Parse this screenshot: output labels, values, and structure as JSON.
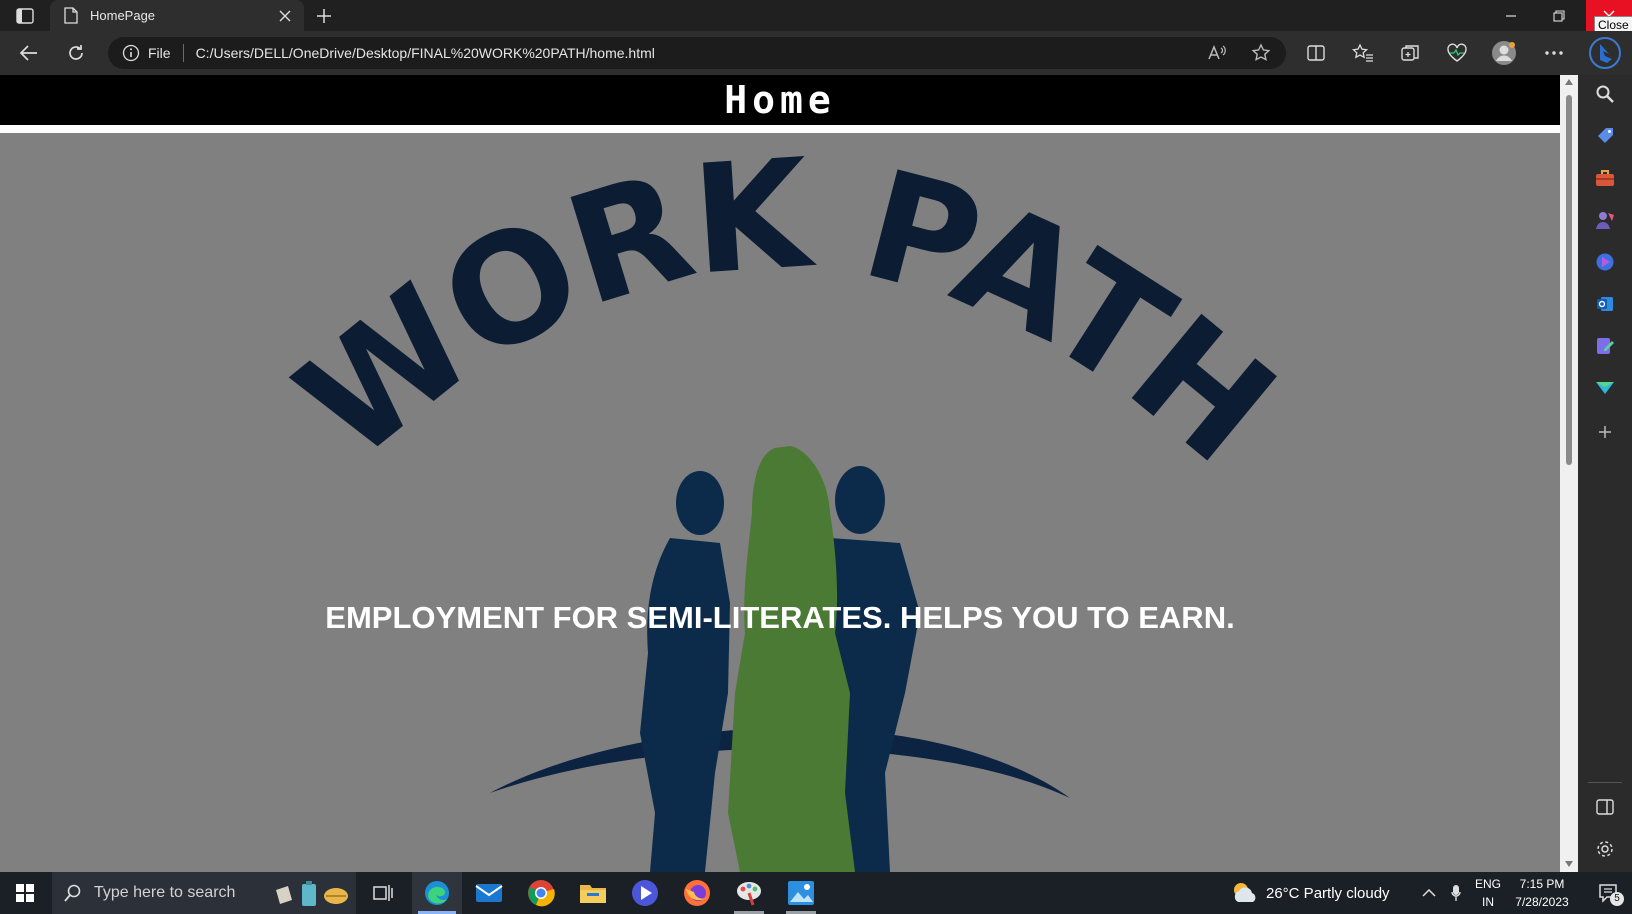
{
  "browser": {
    "tab": {
      "title": "HomePage"
    },
    "address": {
      "scheme_label": "File",
      "url": "C:/Users/DELL/OneDrive/Desktop/FINAL%20WORK%20PATH/home.html"
    },
    "close_tooltip": "Close"
  },
  "page": {
    "header_title": "Home",
    "logo": {
      "word_work": "WORK",
      "word_path": "PATH"
    },
    "tagline": "EMPLOYMENT FOR SEMI-LITERATES. HELPS YOU TO EARN."
  },
  "colors": {
    "logo_navy": "#0c2341",
    "figure_green": "#4b7a34",
    "page_gray": "#808080",
    "header_black": "#000000"
  },
  "taskbar": {
    "search_placeholder": "Type here to search",
    "weather": "26°C  Partly cloudy",
    "lang_top": "ENG",
    "lang_bottom": "IN",
    "time": "7:15 PM",
    "date": "7/28/2023",
    "notification_count": "5"
  }
}
